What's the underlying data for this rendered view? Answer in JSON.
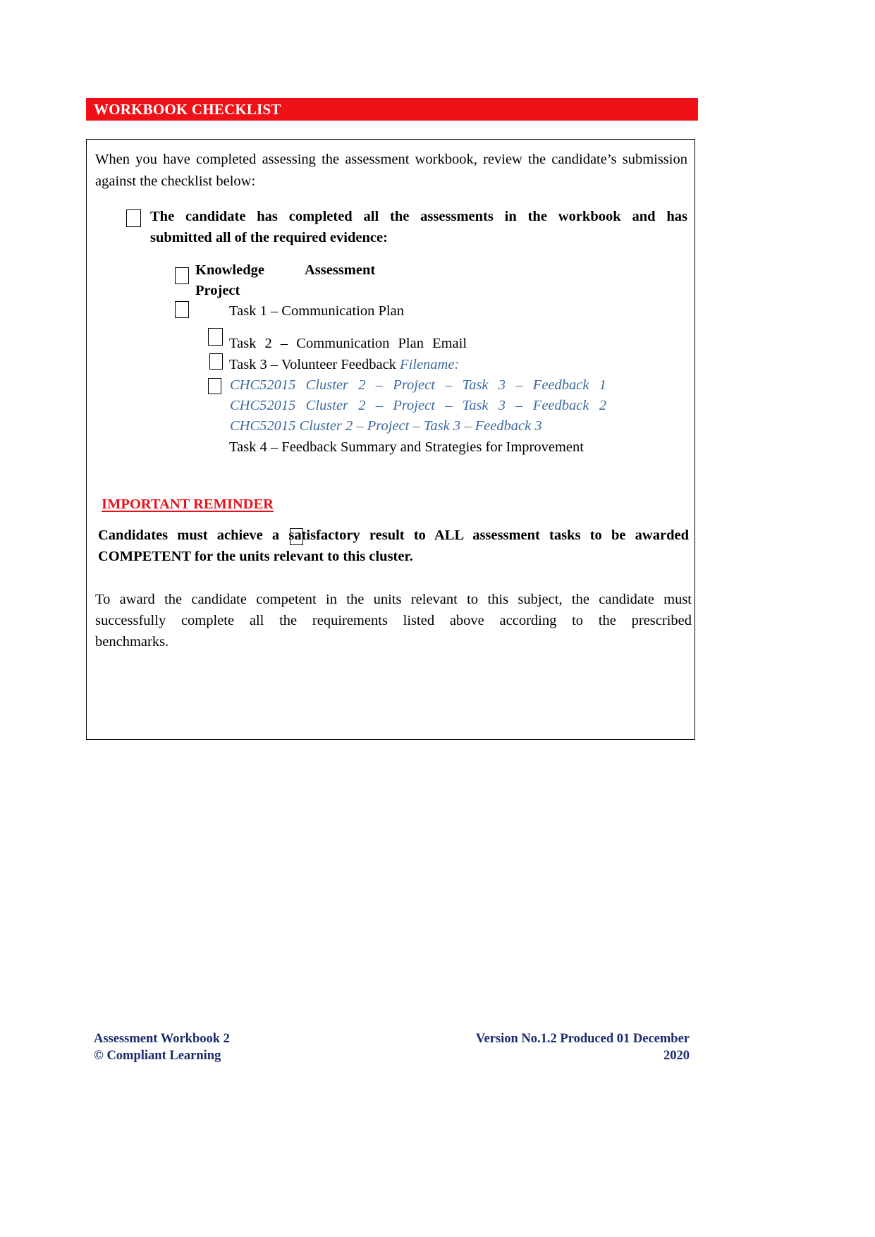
{
  "header": {
    "title": "WORKBOOK CHECKLIST"
  },
  "intro": {
    "paragraph": "When you have completed assessing the assessment workbook, review the candidate’s submission against the checklist below:"
  },
  "main_item": {
    "line1": "The candidate has completed all the assessments in the workbook and has",
    "line2": "submitted all of the required evidence:"
  },
  "checklist": {
    "knowledge_assessment": "Knowledge",
    "knowledge_assessment_2": "Assessment",
    "project": "Project",
    "task1": "Task 1 – Communication Plan",
    "task2": "Task 2 – Communication Plan Email",
    "task3": "Task 3 – Volunteer Feedback",
    "task3_filename_label": "Filename:",
    "filename1": "CHC52015 Cluster 2 – Project – Task 3 – Feedback 1",
    "filename2": "CHC52015 Cluster 2 – Project – Task 3 – Feedback 2",
    "filename3": "CHC52015 Cluster 2 – Project – Task 3 – Feedback 3",
    "task4": "Task 4 – Feedback Summary and Strategies for Improvement"
  },
  "reminder": {
    "heading": "IMPORTANT REMINDER",
    "line1": "Candidates must achieve a satisfactory result to ALL assessment tasks to be awarded",
    "line2": "COMPETENT for the units relevant to this cluster."
  },
  "closing": {
    "line1": "To award the candidate competent in the units relevant to this subject, the candidate must",
    "line2": "successfully complete all the requirements listed above according to the prescribed",
    "line3": "benchmarks."
  },
  "footer": {
    "left_line1": "Assessment Workbook 2",
    "left_line2": "© Compliant Learning",
    "right_line1": "Version No.1.2 Produced 01 December",
    "right_line2": "2020"
  },
  "colors": {
    "banner_red": "#ee1118",
    "reminder_red": "#e8121b",
    "filename_blue": "#3d6a9e",
    "footer_navy": "#1b2b6b"
  }
}
